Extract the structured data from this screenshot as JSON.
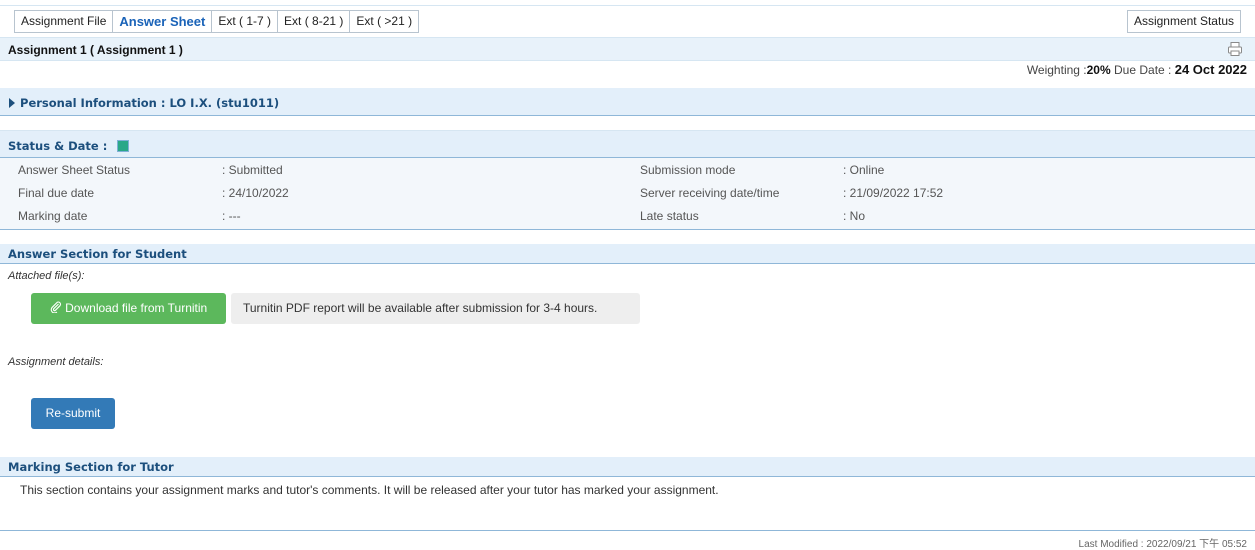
{
  "tabs": [
    {
      "label": "Assignment File"
    },
    {
      "label": "Answer Sheet"
    },
    {
      "label": "Ext ( 1-7 )"
    },
    {
      "label": "Ext ( 8-21 )"
    },
    {
      "label": "Ext ( >21 )"
    }
  ],
  "active_tab": "Answer Sheet",
  "tab_right": "Assignment Status",
  "title": "Assignment 1 ( Assignment 1 )",
  "weighting": {
    "label": "Weighting :",
    "value": "20%",
    "due_label": "Due Date :",
    "due_value": "24 Oct 2022"
  },
  "personal": {
    "label": "Personal Information : LO I.X. (stu1011)"
  },
  "status": {
    "header": "Status & Date :",
    "rows": [
      {
        "l1": "Answer Sheet Status",
        "v1": ": Submitted",
        "l2": "Submission mode",
        "v2": ": Online"
      },
      {
        "l1": "Final due date",
        "v1": ": 24/10/2022",
        "l2": "Server receiving date/time",
        "v2": ": 21/09/2022 17:52"
      },
      {
        "l1": "Marking date",
        "v1": ": ---",
        "l2": "Late status",
        "v2": ": No"
      }
    ]
  },
  "answer": {
    "header": "Answer Section for Student",
    "attached_label": "Attached file(s):",
    "download_button": "Download file from Turnitin",
    "notice": "Turnitin PDF report will be available after submission for 3-4 hours.",
    "details_label": "Assignment details:",
    "resubmit_button": "Re-submit"
  },
  "marking": {
    "header": "Marking Section for Tutor",
    "text": "This section contains your assignment marks and tutor's comments. It will be released after your tutor has marked your assignment."
  },
  "last_modified": "Last Modified : 2022/09/21 下午 05:52",
  "icons": [
    "print-icon",
    "triangle-right-icon",
    "status-square-icon",
    "paperclip-icon"
  ],
  "colors": {
    "active_tab": "#1a63b8",
    "section_header": "#1c4f7d",
    "download_btn": "#5cb85c",
    "resubmit_btn": "#337ab7",
    "status_square": "#2aa888"
  }
}
